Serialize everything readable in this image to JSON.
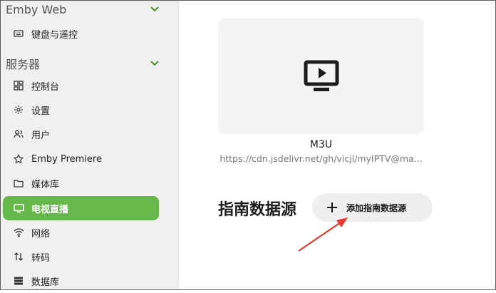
{
  "sidebar": {
    "section_emby": {
      "title": "Emby Web"
    },
    "keyboard": {
      "label": "键盘与遥控"
    },
    "section_server": {
      "title": "服务器"
    },
    "items": [
      {
        "label": "控制台"
      },
      {
        "label": "设置"
      },
      {
        "label": "用户"
      },
      {
        "label": "Emby Premiere"
      },
      {
        "label": "媒体库"
      },
      {
        "label": "电视直播",
        "active": true
      },
      {
        "label": "网络"
      },
      {
        "label": "转码"
      },
      {
        "label": "数据库"
      }
    ],
    "active_color": "#66b84a"
  },
  "main": {
    "tuner_card": {
      "icon": "tv-play-icon",
      "title": "M3U",
      "url": "https://cdn.jsdelivr.net/gh/vicjl/myIPTV@ma..."
    },
    "guide": {
      "title": "指南数据源",
      "add_button": "添加指南数据源"
    }
  },
  "annotation": {
    "color": "#e8382c"
  }
}
